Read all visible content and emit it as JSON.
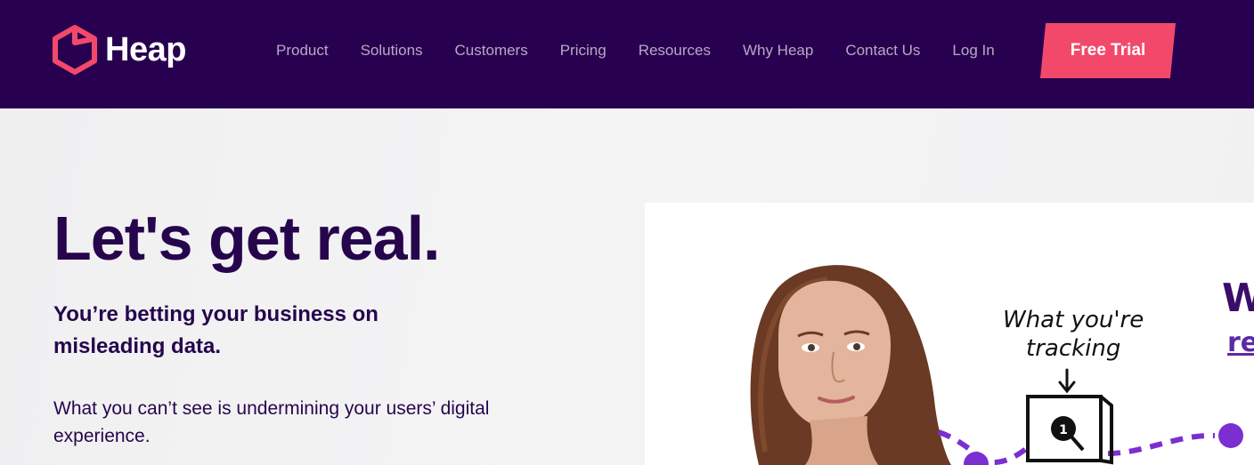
{
  "brand": {
    "name": "Heap",
    "logo_icon": "hexagon-cube-icon",
    "colors": {
      "header_bg": "#280050",
      "accent": "#f2496b",
      "headline": "#26054d",
      "illustration_accent": "#7b2fd0"
    }
  },
  "nav": {
    "items": [
      {
        "label": "Product"
      },
      {
        "label": "Solutions"
      },
      {
        "label": "Customers"
      },
      {
        "label": "Pricing"
      },
      {
        "label": "Resources"
      },
      {
        "label": "Why Heap"
      },
      {
        "label": "Contact Us"
      },
      {
        "label": "Log In"
      }
    ],
    "cta": "Free Trial"
  },
  "hero": {
    "headline": "Let's get real.",
    "subhead": "You’re betting your business on misleading data.",
    "body": "What you can’t see is undermining your users’ digital experience."
  },
  "illustration": {
    "handwriting_line1": "What you're",
    "handwriting_line2": "tracking",
    "corner_partial_1": "W",
    "corner_partial_2": "re"
  }
}
